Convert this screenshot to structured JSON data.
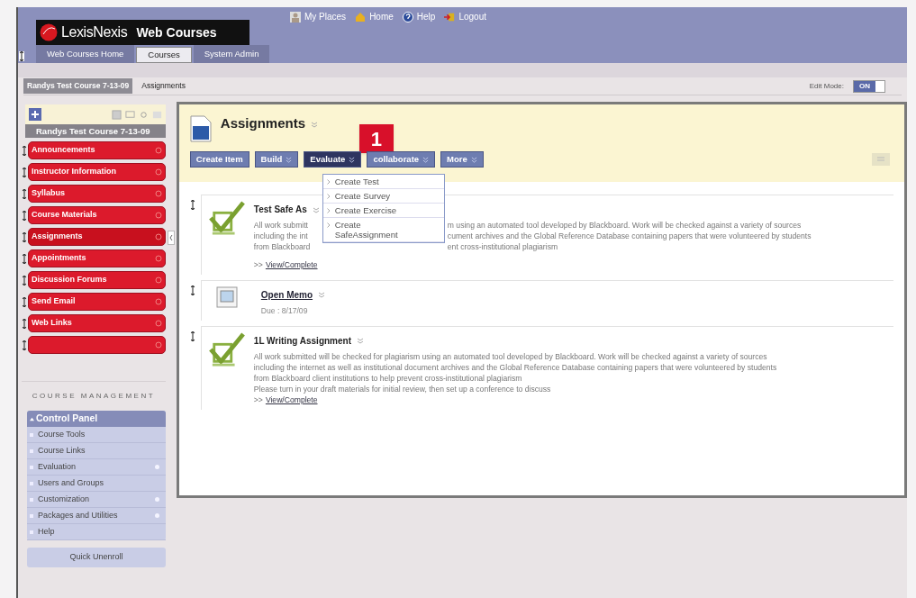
{
  "top_links": [
    {
      "label": "My Places",
      "kind": "person"
    },
    {
      "label": "Home",
      "kind": "home"
    },
    {
      "label": "Help",
      "kind": "help"
    },
    {
      "label": "Logout",
      "kind": "logout"
    }
  ],
  "logo": {
    "brand": "LexisNexis",
    "product": "Web Courses"
  },
  "tabs": [
    {
      "label": "Web Courses Home",
      "selected": false
    },
    {
      "label": "Courses",
      "selected": true
    },
    {
      "label": "System Admin",
      "selected": false
    }
  ],
  "breadcrumb": {
    "course": "Randys Test Course 7-13-09",
    "page": "Assignments"
  },
  "edit_mode": {
    "label": "Edit Mode:",
    "value": "ON",
    "on": true
  },
  "course_menu": {
    "title": "Randys Test Course 7-13-09",
    "items": [
      {
        "label": "Announcements",
        "selected": false
      },
      {
        "label": "Instructor Information",
        "selected": false
      },
      {
        "label": "Syllabus",
        "selected": false
      },
      {
        "label": "Course Materials",
        "selected": false
      },
      {
        "label": "Assignments",
        "selected": true
      },
      {
        "label": "Appointments",
        "selected": false
      },
      {
        "label": "Discussion Forums",
        "selected": false
      },
      {
        "label": "Send Email",
        "selected": false
      },
      {
        "label": "Web Links",
        "selected": false
      },
      {
        "selected": false
      }
    ]
  },
  "course_management": {
    "heading": "COURSE MANAGEMENT",
    "control_panel": {
      "title": "Control Panel",
      "expanded": true,
      "items": [
        {
          "label": "Course Tools",
          "submenu": false
        },
        {
          "label": "Course Links",
          "submenu": false
        },
        {
          "label": "Evaluation",
          "submenu": true
        },
        {
          "label": "Users and Groups",
          "submenu": false
        },
        {
          "label": "Customization",
          "submenu": true
        },
        {
          "label": "Packages and Utilities",
          "submenu": true
        },
        {
          "label": "Help",
          "submenu": false
        }
      ]
    },
    "quick_unenroll": "Quick Unenroll"
  },
  "content": {
    "title": "Assignments",
    "annotation": "1",
    "buttons": [
      {
        "label": "Create Item",
        "kind": "plain",
        "selected": false
      },
      {
        "label": "Build",
        "kind": "menu",
        "selected": false
      },
      {
        "label": "Evaluate",
        "kind": "menu",
        "selected": true
      },
      {
        "label": "collaborate",
        "kind": "menu",
        "selected": false
      },
      {
        "label": "More",
        "kind": "menu",
        "selected": false
      }
    ],
    "dropdown": [
      "Create Test",
      "Create Survey",
      "Create Exercise",
      "Create SafeAssignment"
    ],
    "items": [
      {
        "kind": "assignment",
        "title": "Test Safe As",
        "lines": [
          [
            "All work submitt",
            "m using an automated tool developed by Blackboard. Work will be checked against a variety of sources"
          ],
          [
            "including the int",
            "cument archives and the Global Reference Database containing papers that were volunteered by students"
          ],
          [
            "from Blackboard",
            "ent cross-institutional plagiarism"
          ]
        ],
        "link_prefix": ">>",
        "link": "View/Complete"
      },
      {
        "kind": "memo",
        "title": "Open Memo",
        "due": "Due : 8/17/09"
      },
      {
        "kind": "assignment",
        "title": "1L Writing Assignment",
        "lines": [
          [
            "All work submitted will be checked for plagiarism using an automated tool developed by Blackboard. Work will be checked against a variety of sources"
          ],
          [
            "including the internet as well as institutional document archives and the Global Reference Database containing papers that were volunteered by students"
          ],
          [
            "from Blackboard client institutions to help prevent cross-institutional plagiarism"
          ],
          [
            "Please turn in your draft materials for initial review, then set up a conference to discuss"
          ]
        ],
        "link_prefix": ">>",
        "link": "View/Complete"
      }
    ]
  }
}
